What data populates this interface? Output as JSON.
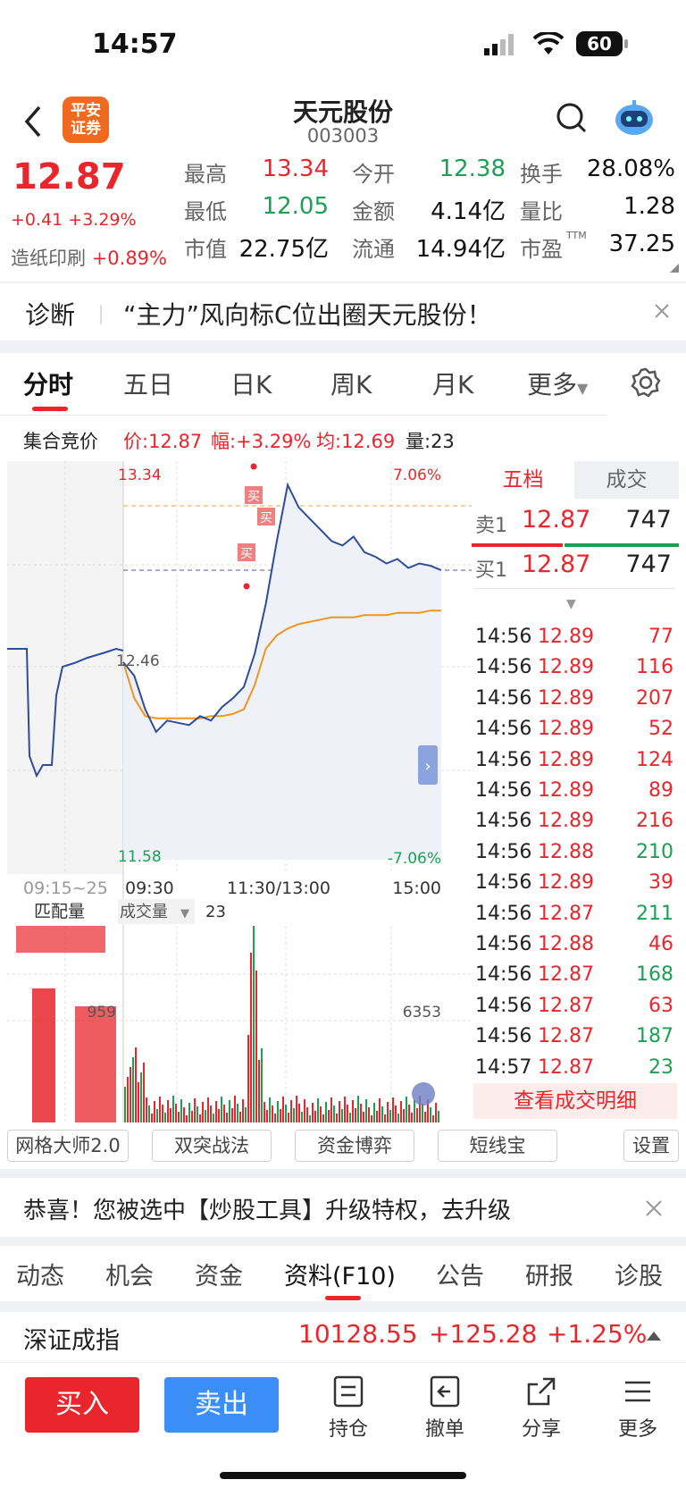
{
  "status": {
    "time": "14:57",
    "battery": "60"
  },
  "nav": {
    "broker_logo": "平安\n证券",
    "title": "天元股份",
    "code": "003003"
  },
  "quote": {
    "price": "12.87",
    "change": "+0.41",
    "change_pct": "+3.29%",
    "sector_name": "造纸印刷",
    "sector_pct": "+0.89%",
    "cells": [
      {
        "label": "最高",
        "value": "13.34",
        "color": "red"
      },
      {
        "label": "今开",
        "value": "12.38",
        "color": "green"
      },
      {
        "label": "换手",
        "value": "28.08%",
        "color": "black"
      },
      {
        "label": "最低",
        "value": "12.05",
        "color": "green"
      },
      {
        "label": "金额",
        "value": "4.14亿",
        "color": "black"
      },
      {
        "label": "量比",
        "value": "1.28",
        "color": "black"
      },
      {
        "label": "市值",
        "value": "22.75亿",
        "color": "black"
      },
      {
        "label": "流通",
        "value": "14.94亿",
        "color": "black"
      },
      {
        "label": "市盈",
        "value": "37.25",
        "color": "black",
        "sup": "TTM"
      }
    ]
  },
  "diagnosis": {
    "label": "诊断",
    "text": "“主力”风向标C位出圈天元股份！"
  },
  "chart_tabs": [
    "分时",
    "五日",
    "日K",
    "周K",
    "月K",
    "更多"
  ],
  "auction": {
    "label": "集合竞价",
    "price": "价:12.87",
    "range": "幅:+3.29%",
    "avg": "均:12.69",
    "vol": "量:23"
  },
  "chart": {
    "ymax": "13.34",
    "ymid": "12.46",
    "ymin": "11.58",
    "pmax": "7.06%",
    "pmin": "-7.06%",
    "times": [
      "09:15~25",
      "09:30",
      "11:30/13:00",
      "15:00"
    ],
    "vol_label_left": "匹配量",
    "vol_label": "成交量",
    "vol_value": "23",
    "vol_ref_left": "959",
    "vol_ref_right": "6353",
    "buy_mark": "买"
  },
  "chart_data": {
    "type": "line",
    "title": "",
    "series": [
      {
        "values": [
          12.46,
          12.4,
          12.25,
          12.15,
          12.2,
          12.19,
          12.18,
          12.22,
          12.2,
          12.26,
          12.3,
          12.35,
          12.5,
          12.72,
          13.0,
          13.25,
          13.15,
          13.1,
          13.05,
          13.0,
          12.98,
          13.02,
          12.95,
          12.93,
          12.9,
          12.92,
          12.88,
          12.9,
          12.89,
          12.87
        ]
      },
      {
        "values": [
          12.46,
          12.3,
          12.22,
          12.21,
          12.21,
          12.21,
          12.21,
          12.21,
          12.22,
          12.22,
          12.23,
          12.25,
          12.36,
          12.52,
          12.58,
          12.61,
          12.63,
          12.64,
          12.65,
          12.66,
          12.66,
          12.66,
          12.67,
          12.67,
          12.67,
          12.68,
          12.68,
          12.68,
          12.69,
          12.69
        ]
      }
    ],
    "ylim": [
      11.58,
      13.34
    ]
  },
  "depth": {
    "tab1": "五档",
    "tab2": "成交",
    "sell_label": "卖1",
    "sell_price": "12.87",
    "sell_vol": "747",
    "buy_label": "买1",
    "buy_price": "12.87",
    "buy_vol": "747"
  },
  "trades": [
    {
      "t": "14:56",
      "p": "12.89",
      "v": "77",
      "c": "red"
    },
    {
      "t": "14:56",
      "p": "12.89",
      "v": "116",
      "c": "red"
    },
    {
      "t": "14:56",
      "p": "12.89",
      "v": "207",
      "c": "red"
    },
    {
      "t": "14:56",
      "p": "12.89",
      "v": "52",
      "c": "red"
    },
    {
      "t": "14:56",
      "p": "12.89",
      "v": "124",
      "c": "red"
    },
    {
      "t": "14:56",
      "p": "12.89",
      "v": "89",
      "c": "red"
    },
    {
      "t": "14:56",
      "p": "12.89",
      "v": "216",
      "c": "red"
    },
    {
      "t": "14:56",
      "p": "12.88",
      "v": "210",
      "c": "green"
    },
    {
      "t": "14:56",
      "p": "12.89",
      "v": "39",
      "c": "red"
    },
    {
      "t": "14:56",
      "p": "12.87",
      "v": "211",
      "c": "green"
    },
    {
      "t": "14:56",
      "p": "12.88",
      "v": "46",
      "c": "red"
    },
    {
      "t": "14:56",
      "p": "12.87",
      "v": "168",
      "c": "green"
    },
    {
      "t": "14:56",
      "p": "12.87",
      "v": "63",
      "c": "red"
    },
    {
      "t": "14:56",
      "p": "12.87",
      "v": "187",
      "c": "green"
    },
    {
      "t": "14:57",
      "p": "12.87",
      "v": "23",
      "c": "green"
    }
  ],
  "trade_detail": "查看成交明细",
  "tools": [
    "网格大师2.0",
    "双突战法",
    "资金博弈",
    "短线宝"
  ],
  "tools_setting": "设置",
  "promo": "恭喜！您被选中【炒股工具】升级特权，去升级",
  "bottom_tabs": [
    "动态",
    "机会",
    "资金",
    "资料(F10)",
    "公告",
    "研报",
    "诊股"
  ],
  "index": {
    "name": "深证成指",
    "value": "10128.55",
    "change": "+125.28",
    "pct": "+1.25%"
  },
  "actions": {
    "buy": "买入",
    "sell": "卖出",
    "hold": "持仓",
    "cancel": "撤单",
    "share": "分享",
    "more": "更多"
  }
}
